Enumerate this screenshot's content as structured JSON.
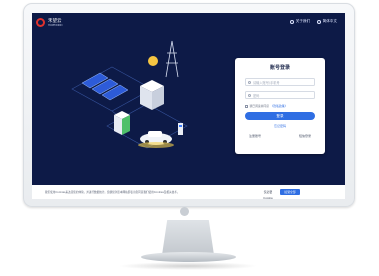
{
  "app": {
    "brand_name": "禾望云",
    "brand_sub": "HOPEWIND"
  },
  "header": {
    "about_label": "关于我们",
    "language_label": "简体中文"
  },
  "login": {
    "title": "账号登录",
    "username_placeholder": "请输入账号/手机号",
    "password_placeholder": "密码",
    "agree_text": "我已阅读并同意",
    "agree_link": "《隐私政策》",
    "login_button": "登录",
    "forgot_label": "忘记密码",
    "register_label": "注册账号",
    "phone_login_label": "短信登录"
  },
  "cookie": {
    "text": "我们使用Cookies来改善您的体验，并进行数据统计。您继续浏览本网站即表示您同意我们使用Cookies及相关技术。",
    "decline_label": "仅必要Cookie",
    "accept_label": "接受全部"
  },
  "colors": {
    "screen_bg": "#0d1a47",
    "accent": "#2f6ee3",
    "brand_red": "#e0322d"
  },
  "icons": [
    "logo-icon",
    "about-icon",
    "globe-icon",
    "user-icon",
    "lock-icon"
  ]
}
